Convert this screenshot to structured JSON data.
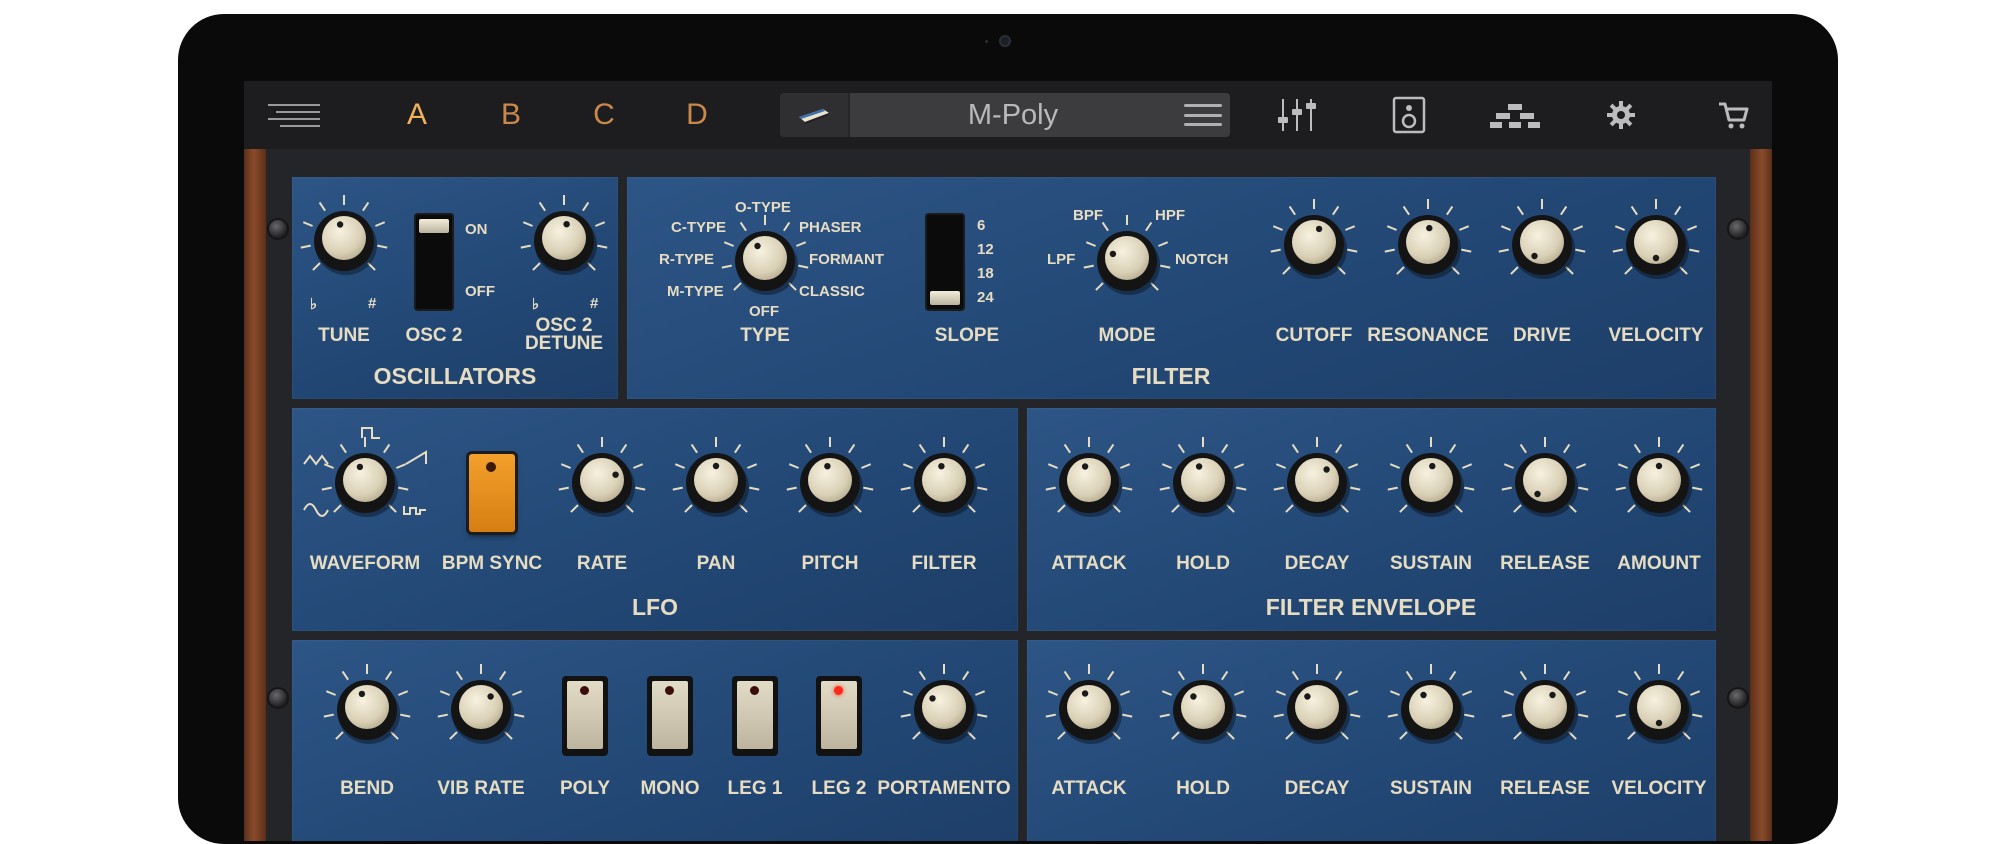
{
  "topbar": {
    "presets": [
      "A",
      "B",
      "C",
      "D"
    ],
    "active_preset": "A",
    "preset_name": "M-Poly"
  },
  "oscillators": {
    "title": "OSCILLATORS",
    "tune_label": "TUNE",
    "tune_flat": "♭",
    "tune_sharp": "#",
    "osc2_label": "OSC 2",
    "osc2_on": "ON",
    "osc2_off": "OFF",
    "detune_label": "OSC 2\nDETUNE",
    "detune_flat": "♭",
    "detune_sharp": "#"
  },
  "filter": {
    "title": "FILTER",
    "type_label": "TYPE",
    "type_options": {
      "otype": "O-TYPE",
      "ctype": "C-TYPE",
      "phaser": "PHASER",
      "rtype": "R-TYPE",
      "formant": "FORMANT",
      "mtype": "M-TYPE",
      "classic": "CLASSIC",
      "off": "OFF"
    },
    "slope_label": "SLOPE",
    "slope_values": [
      "6",
      "12",
      "18",
      "24"
    ],
    "mode_label": "MODE",
    "mode_options": {
      "bpf": "BPF",
      "hpf": "HPF",
      "lpf": "LPF",
      "notch": "NOTCH"
    },
    "cutoff_label": "CUTOFF",
    "resonance_label": "RESONANCE",
    "drive_label": "DRIVE",
    "velocity_label": "VELOCITY"
  },
  "lfo": {
    "title": "LFO",
    "waveform_label": "WAVEFORM",
    "bpm_sync_label": "BPM SYNC",
    "rate_label": "RATE",
    "pan_label": "PAN",
    "pitch_label": "PITCH",
    "filter_label": "FILTER"
  },
  "filter_envelope": {
    "title": "FILTER ENVELOPE",
    "attack_label": "ATTACK",
    "hold_label": "HOLD",
    "decay_label": "DECAY",
    "sustain_label": "SUSTAIN",
    "release_label": "RELEASE",
    "amount_label": "AMOUNT"
  },
  "performance": {
    "bend_label": "BEND",
    "vib_rate_label": "VIB RATE",
    "poly_label": "POLY",
    "mono_label": "MONO",
    "leg1_label": "LEG 1",
    "leg2_label": "LEG 2",
    "portamento_label": "PORTAMENTO"
  },
  "amp_envelope": {
    "attack_label": "ATTACK",
    "hold_label": "HOLD",
    "decay_label": "DECAY",
    "sustain_label": "SUSTAIN",
    "release_label": "RELEASE",
    "velocity_label": "VELOCITY"
  },
  "colors": {
    "panel_blue": "#244a78",
    "label_cream": "#e6dcc2",
    "preset_orange": "#c8894a",
    "active_preset": "#f2b05b",
    "bpm_sync_orange": "#e88f1c",
    "led_on_red": "#ff2a1a"
  },
  "icons": [
    "menu-lines-icon",
    "keyboard-icon",
    "hamburger-icon",
    "mixer-sliders-icon",
    "speaker-icon",
    "routing-icon",
    "gear-icon",
    "cart-icon"
  ]
}
